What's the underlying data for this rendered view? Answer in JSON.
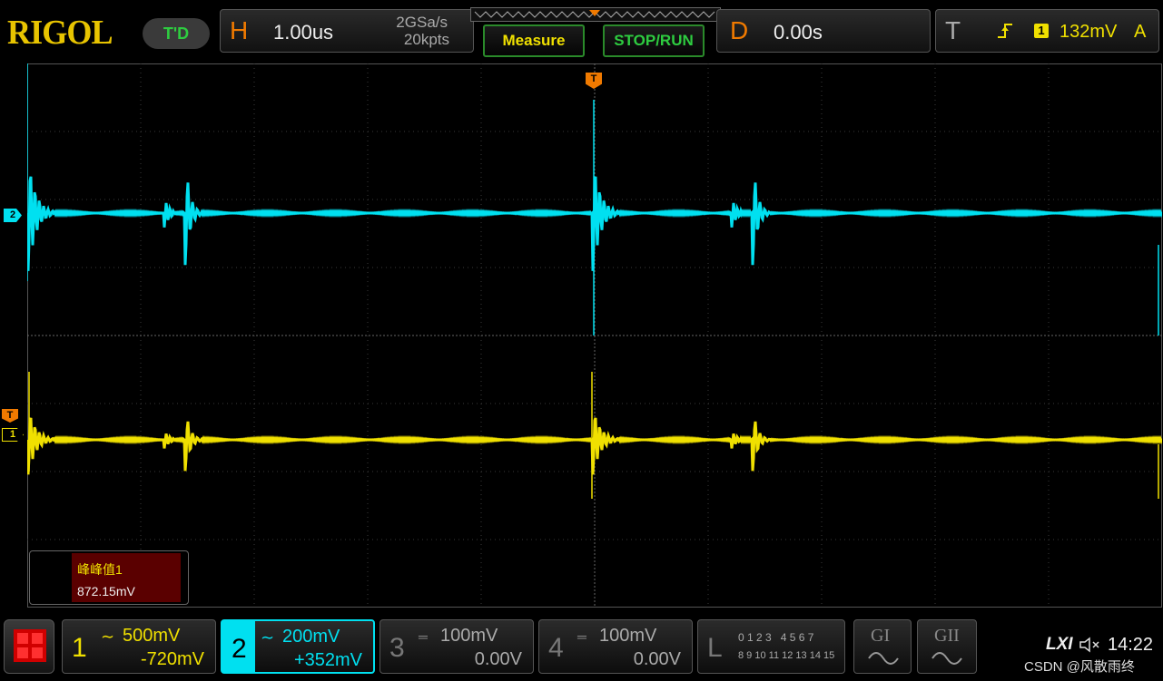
{
  "brand": "RIGOL",
  "trigger_status": "T'D",
  "horizontal": {
    "letter": "H",
    "timebase": "1.00us",
    "sample_rate": "2GSa/s",
    "memory_depth": "20kpts"
  },
  "buttons": {
    "measure": "Measure",
    "stop_run": "STOP/RUN"
  },
  "delay": {
    "letter": "D",
    "value": "0.00s"
  },
  "trigger": {
    "letter": "T",
    "source": "1",
    "level": "132mV",
    "mode": "A"
  },
  "markers": {
    "ch2": "2",
    "ch1": "1",
    "trigger_top": "T",
    "trigger_level": "T"
  },
  "measurement": {
    "name": "峰峰值1",
    "value": "872.15mV"
  },
  "channels": [
    {
      "num": "1",
      "scale": "500mV",
      "offset": "-720mV",
      "color": "#f0e000"
    },
    {
      "num": "2",
      "scale": "200mV",
      "offset": "+352mV",
      "color": "#00e0f0"
    },
    {
      "num": "3",
      "scale": "100mV",
      "offset": "0.00V",
      "color": "#666666"
    },
    {
      "num": "4",
      "scale": "100mV",
      "offset": "0.00V",
      "color": "#666666"
    }
  ],
  "logic": {
    "letter": "L",
    "row1": "0 1 2 3   4 5 6 7",
    "row2": "8 9 10 11 12 13 14 15"
  },
  "gen1": "GI",
  "gen2": "GII",
  "lxi": "LXI",
  "volume_icon": "speaker-mute-icon",
  "clock": "14:22",
  "watermark": "CSDN @风散雨终",
  "colors": {
    "ch1": "#f0e000",
    "ch2": "#00e0f0",
    "accent": "#f07a00",
    "green": "#2ecc40",
    "measure_bg": "#5a0000"
  }
}
